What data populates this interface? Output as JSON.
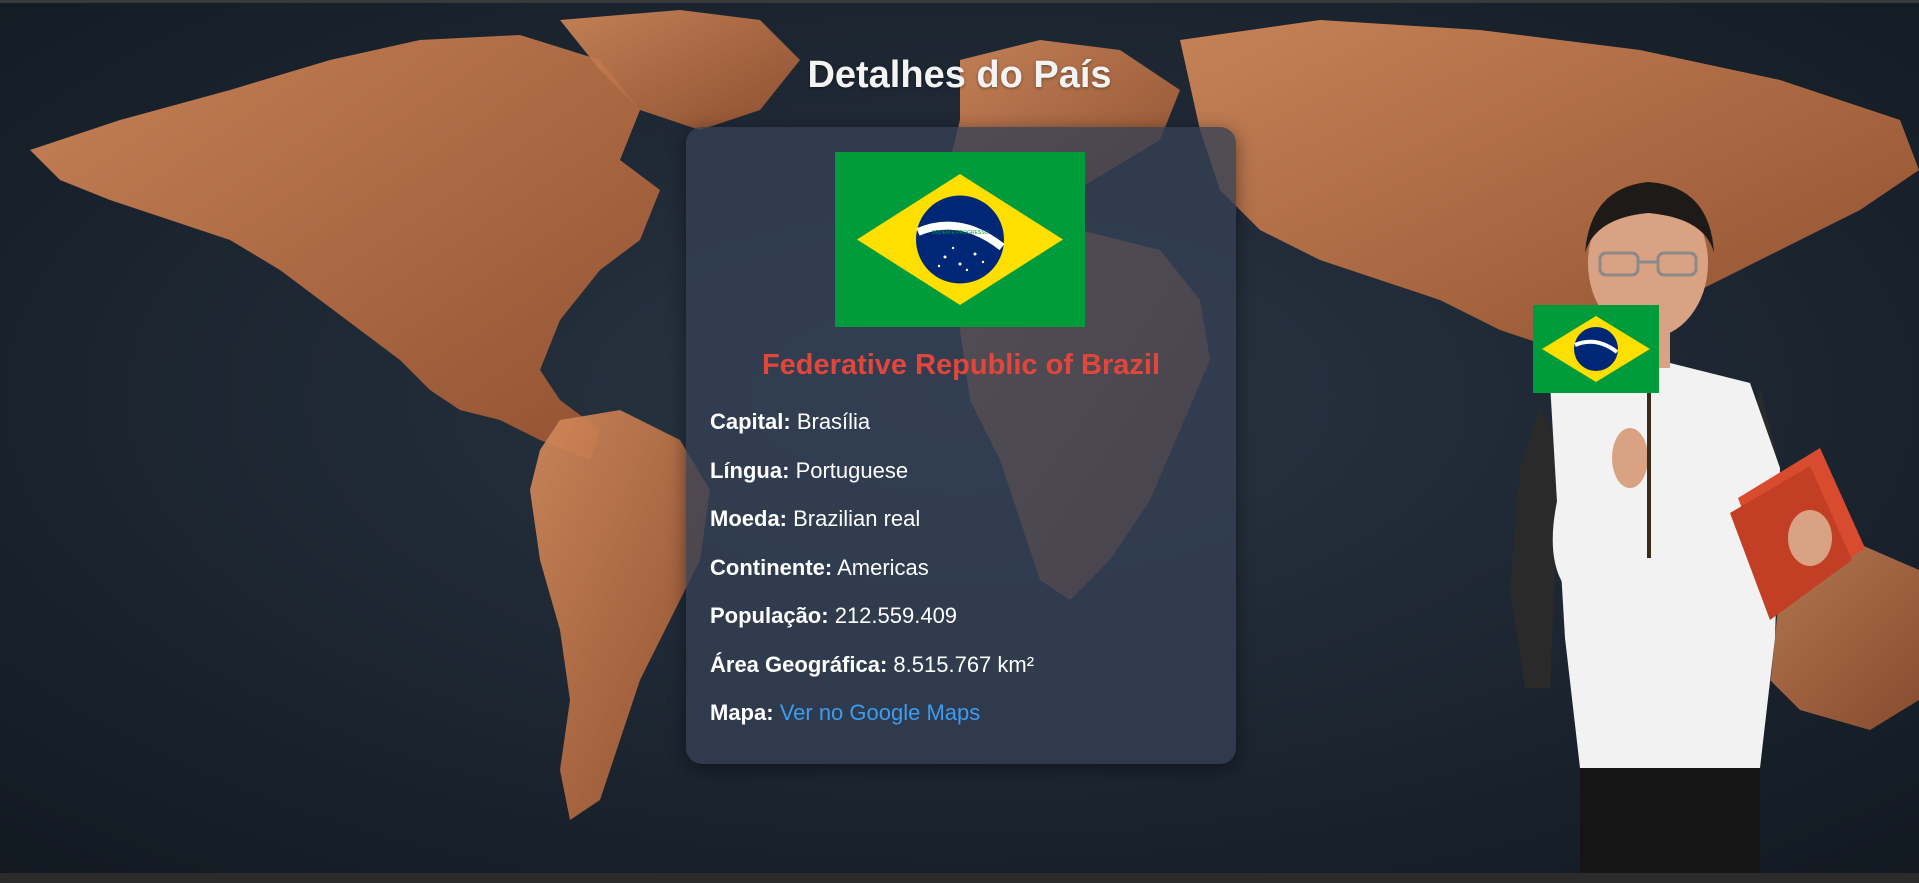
{
  "page": {
    "title": "Detalhes do País"
  },
  "country": {
    "official_name": "Federative Republic of Brazil",
    "flag_icon": "brazil-flag-icon",
    "flag_motto": "ORDEM E PROGRESSO",
    "fields": [
      {
        "label": "Capital:",
        "value": "Brasília"
      },
      {
        "label": "Língua:",
        "value": "Portuguese"
      },
      {
        "label": "Moeda:",
        "value": "Brazilian real"
      },
      {
        "label": "Continente:",
        "value": "Americas"
      },
      {
        "label": "População:",
        "value": "212.559.409"
      },
      {
        "label": "Área Geográfica:",
        "value": "8.515.767 km²"
      }
    ],
    "map": {
      "label": "Mapa:",
      "link_text": "Ver no Google Maps"
    }
  },
  "colors": {
    "title": "#f3f3f3",
    "country_name": "#e2463b",
    "link": "#3d9cf0",
    "card_bg": "#344054",
    "flag_green": "#009c3b",
    "flag_yellow": "#ffdf00",
    "flag_blue": "#002776",
    "map_land": "#c97a4c",
    "map_ocean": "#1b2430"
  }
}
